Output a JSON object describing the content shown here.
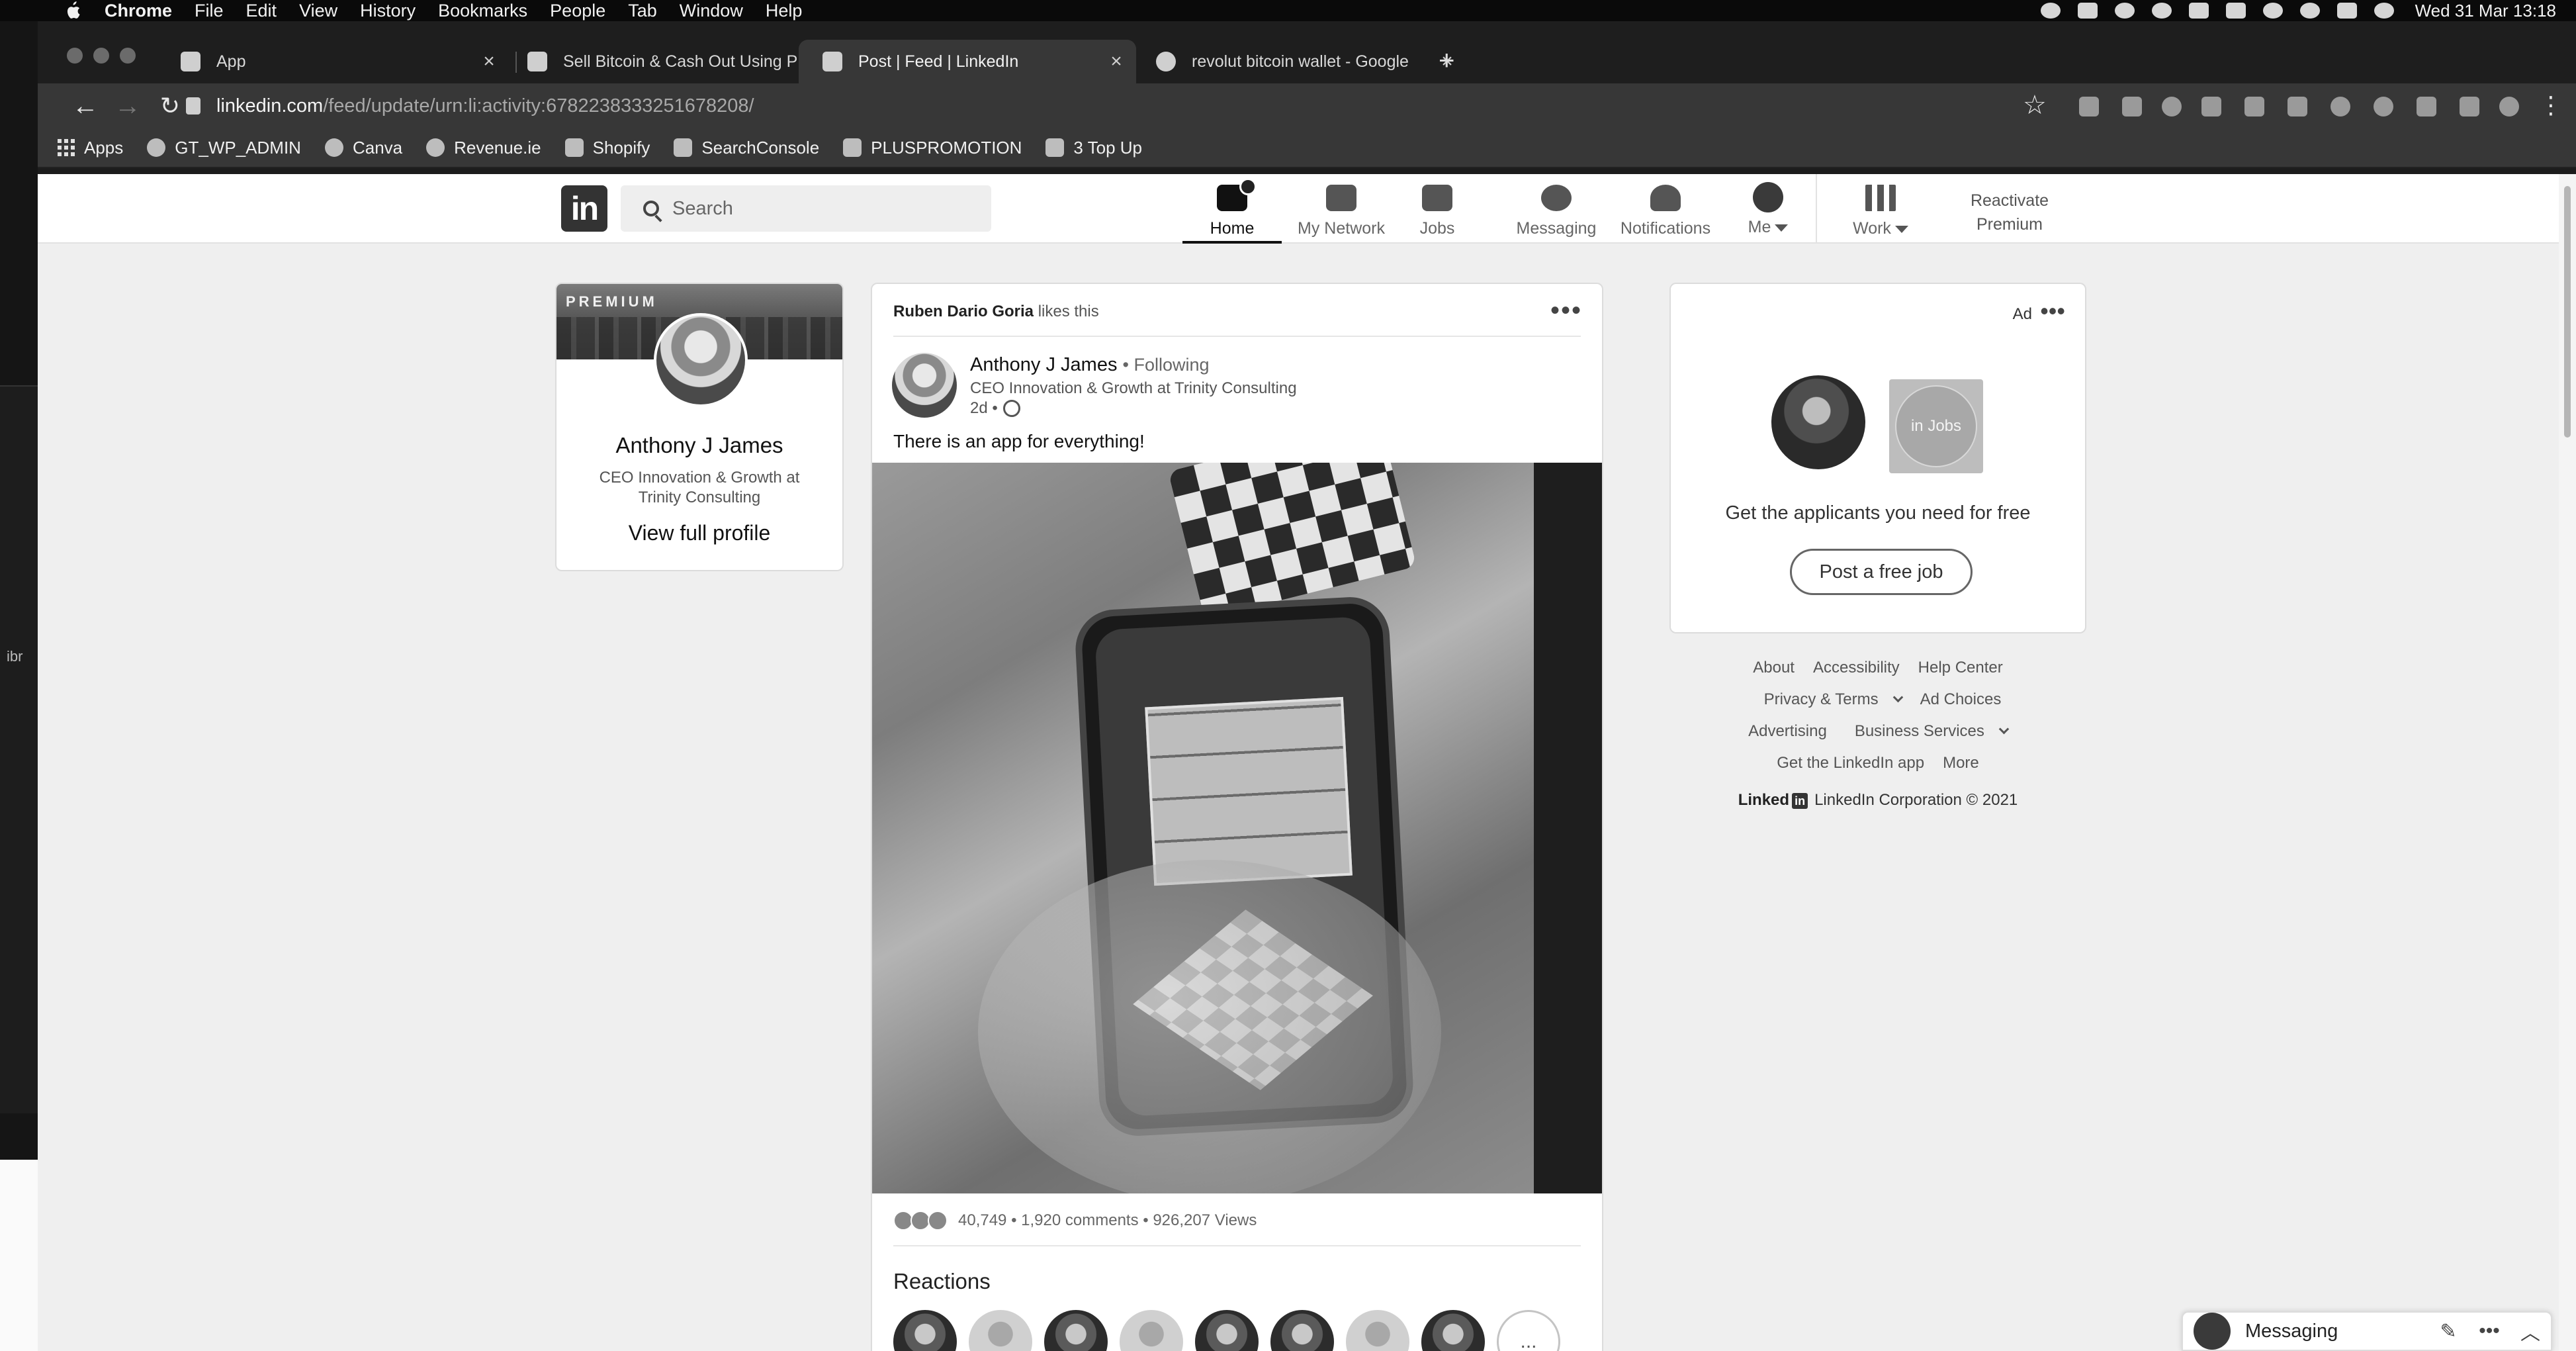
{
  "menubar": {
    "items": [
      "Chrome",
      "File",
      "Edit",
      "View",
      "History",
      "Bookmarks",
      "People",
      "Tab",
      "Window",
      "Help"
    ],
    "clock": "Wed 31 Mar  13:18"
  },
  "desktop": {
    "side_label": "ibr"
  },
  "tabs": [
    {
      "title": "App",
      "close": "×"
    },
    {
      "title": "Sell Bitcoin & Cash Out Using P",
      "close": "×"
    },
    {
      "title": "Post | Feed | LinkedIn",
      "close": "×"
    },
    {
      "title": "revolut bitcoin wallet - Google",
      "close": "×"
    }
  ],
  "newtab": "+",
  "address": {
    "host": "linkedin.com",
    "path": "/feed/update/urn:li:activity:6782238333251678208/"
  },
  "bookmarks": [
    "Apps",
    "GT_WP_ADMIN",
    "Canva",
    "Revenue.ie",
    "Shopify",
    "SearchConsole",
    "PLUSPROMOTION",
    "3 Top Up"
  ],
  "linkedin": {
    "logo": "in",
    "search_placeholder": "Search",
    "nav": {
      "home": "Home",
      "network": "My Network",
      "jobs": "Jobs",
      "messaging": "Messaging",
      "notifications": "Notifications",
      "me": "Me",
      "work": "Work"
    },
    "premium_line1": "Reactivate",
    "premium_line2": "Premium"
  },
  "profile": {
    "tag": "PREMIUM",
    "name": "Anthony J James",
    "title": "CEO Innovation & Growth at Trinity Consulting",
    "link": "View full profile"
  },
  "post": {
    "social_actor": "Ruben Dario Goria",
    "social_action": "likes this",
    "more": "•••",
    "author": "Anthony J James",
    "following": "• Following",
    "headline": "CEO Innovation & Growth at Trinity Consulting",
    "time": "2d •",
    "text": "There is an app for everything!",
    "reactions_count": "40,749",
    "comments": "1,920 comments",
    "views": "926,207 Views",
    "stats_sep": "•",
    "reactions_heading": "Reactions",
    "more_reactors": "..."
  },
  "ad": {
    "label": "Ad",
    "dots": "•••",
    "jobs_logo": "in Jobs",
    "text": "Get the applicants you need for free",
    "button": "Post a free job"
  },
  "footer": {
    "about": "About",
    "accessibility": "Accessibility",
    "help": "Help Center",
    "privacy": "Privacy & Terms",
    "adchoices": "Ad Choices",
    "advertising": "Advertising",
    "business": "Business Services",
    "getapp": "Get the LinkedIn app",
    "more": "More",
    "brand": "Linked",
    "brand_in": "in",
    "copyright": "LinkedIn Corporation © 2021"
  },
  "messaging": {
    "label": "Messaging",
    "compose": "✎",
    "options": "•••",
    "collapse": "︿"
  }
}
